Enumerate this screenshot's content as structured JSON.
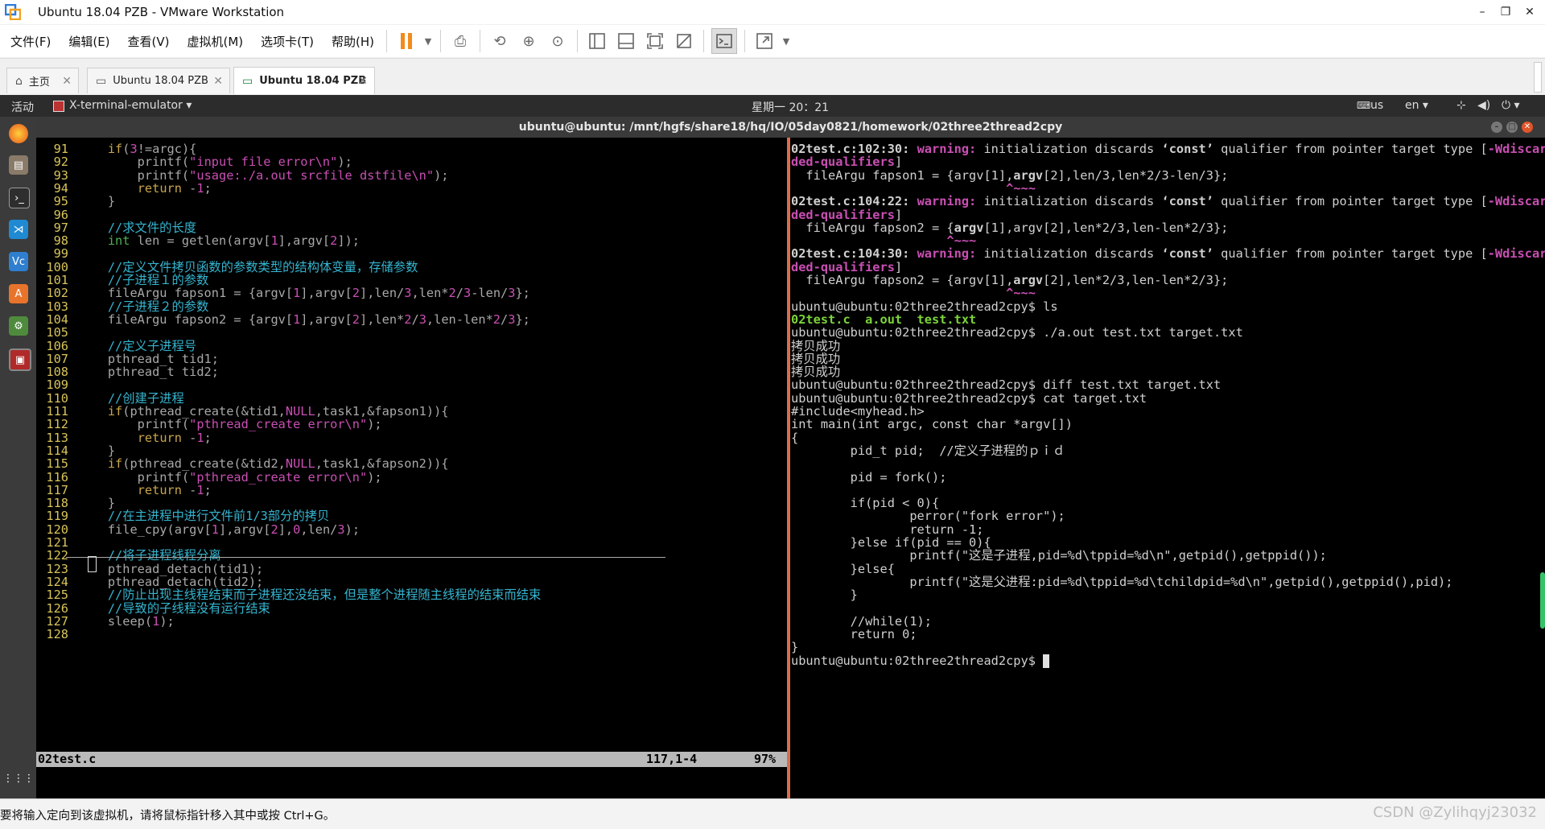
{
  "window": {
    "title": "Ubuntu 18.04 PZB - VMware Workstation",
    "minimize": "–",
    "restore": "❐",
    "close": "✕"
  },
  "menu": [
    "文件(F)",
    "编辑(E)",
    "查看(V)",
    "虚拟机(M)",
    "选项卡(T)",
    "帮助(H)"
  ],
  "tabs": [
    {
      "label": "主页",
      "icon": "home-icon"
    },
    {
      "label": "Ubuntu 18.04 PZB",
      "icon": "vm-icon"
    },
    {
      "label": "Ubuntu 18.04 PZB",
      "icon": "vm-icon",
      "active": true
    }
  ],
  "ubuntu_panel": {
    "activities": "活动",
    "app": "X-terminal-emulator ▾",
    "clock": "星期一 20：21",
    "input": "us",
    "lang": "en ▾"
  },
  "terminal_title": "ubuntu@ubuntu: /mnt/hgfs/share18/hq/IO/05day0821/homework/02three2thread2cpy",
  "vim": {
    "status_file": "02test.c",
    "status_pos": "117,1-4",
    "status_pct": "97%",
    "lines": [
      {
        "n": "91",
        "segs": [
          [
            "def",
            "    "
          ],
          [
            "kw",
            "if"
          ],
          [
            "def",
            "("
          ],
          [
            "num",
            "3"
          ],
          [
            "def",
            "!=argc){"
          ]
        ]
      },
      {
        "n": "92",
        "segs": [
          [
            "def",
            "        printf("
          ],
          [
            "str",
            "\"input file error\\n\""
          ],
          [
            "def",
            ");"
          ]
        ]
      },
      {
        "n": "93",
        "segs": [
          [
            "def",
            "        printf("
          ],
          [
            "str",
            "\"usage:./a.out srcfile dstfile\\n\""
          ],
          [
            "def",
            ");"
          ]
        ]
      },
      {
        "n": "94",
        "segs": [
          [
            "def",
            "        "
          ],
          [
            "kw",
            "return"
          ],
          [
            "def",
            " -"
          ],
          [
            "num",
            "1"
          ],
          [
            "def",
            ";"
          ]
        ]
      },
      {
        "n": "95",
        "segs": [
          [
            "def",
            "    }"
          ]
        ]
      },
      {
        "n": "96",
        "segs": []
      },
      {
        "n": "97",
        "segs": [
          [
            "cmt",
            "    //求文件的长度"
          ]
        ]
      },
      {
        "n": "98",
        "segs": [
          [
            "type",
            "    int"
          ],
          [
            "def",
            " len = getlen(argv["
          ],
          [
            "num",
            "1"
          ],
          [
            "def",
            "],argv["
          ],
          [
            "num",
            "2"
          ],
          [
            "def",
            "]);"
          ]
        ]
      },
      {
        "n": "99",
        "segs": []
      },
      {
        "n": "100",
        "segs": [
          [
            "cmt",
            "    //定义文件拷贝函数的参数类型的结构体变量，存储参数"
          ]
        ]
      },
      {
        "n": "101",
        "segs": [
          [
            "cmt",
            "    //子进程１的参数"
          ]
        ]
      },
      {
        "n": "102",
        "segs": [
          [
            "def",
            "    fileArgu fapson1 = {argv["
          ],
          [
            "num",
            "1"
          ],
          [
            "def",
            "],argv["
          ],
          [
            "num",
            "2"
          ],
          [
            "def",
            "],len/"
          ],
          [
            "num",
            "3"
          ],
          [
            "def",
            ",len*"
          ],
          [
            "num",
            "2"
          ],
          [
            "def",
            "/"
          ],
          [
            "num",
            "3"
          ],
          [
            "def",
            "-len/"
          ],
          [
            "num",
            "3"
          ],
          [
            "def",
            "};"
          ]
        ]
      },
      {
        "n": "103",
        "segs": [
          [
            "cmt",
            "    //子进程２的参数"
          ]
        ]
      },
      {
        "n": "104",
        "segs": [
          [
            "def",
            "    fileArgu fapson2 = {argv["
          ],
          [
            "num",
            "1"
          ],
          [
            "def",
            "],argv["
          ],
          [
            "num",
            "2"
          ],
          [
            "def",
            "],len*"
          ],
          [
            "num",
            "2"
          ],
          [
            "def",
            "/"
          ],
          [
            "num",
            "3"
          ],
          [
            "def",
            ",len-len*"
          ],
          [
            "num",
            "2"
          ],
          [
            "def",
            "/"
          ],
          [
            "num",
            "3"
          ],
          [
            "def",
            "};"
          ]
        ]
      },
      {
        "n": "105",
        "segs": []
      },
      {
        "n": "106",
        "segs": [
          [
            "cmt",
            "    //定义子进程号"
          ]
        ]
      },
      {
        "n": "107",
        "segs": [
          [
            "def",
            "    pthread_t tid1;"
          ]
        ]
      },
      {
        "n": "108",
        "segs": [
          [
            "def",
            "    pthread_t tid2;"
          ]
        ]
      },
      {
        "n": "109",
        "segs": []
      },
      {
        "n": "110",
        "segs": [
          [
            "cmt",
            "    //创建子进程"
          ]
        ]
      },
      {
        "n": "111",
        "segs": [
          [
            "def",
            "    "
          ],
          [
            "kw",
            "if"
          ],
          [
            "def",
            "(pthread_create(&tid1,"
          ],
          [
            "num",
            "NULL"
          ],
          [
            "def",
            ",task1,&fapson1)){"
          ]
        ]
      },
      {
        "n": "112",
        "segs": [
          [
            "def",
            "        printf("
          ],
          [
            "str",
            "\"pthread_create error\\n\""
          ],
          [
            "def",
            ");"
          ]
        ]
      },
      {
        "n": "113",
        "segs": [
          [
            "def",
            "        "
          ],
          [
            "kw",
            "return"
          ],
          [
            "def",
            " -"
          ],
          [
            "num",
            "1"
          ],
          [
            "def",
            ";"
          ]
        ]
      },
      {
        "n": "114",
        "segs": [
          [
            "def",
            "    }"
          ]
        ]
      },
      {
        "n": "115",
        "segs": [
          [
            "def",
            "    "
          ],
          [
            "kw",
            "if"
          ],
          [
            "def",
            "(pthread_create(&tid2,"
          ],
          [
            "num",
            "NULL"
          ],
          [
            "def",
            ",task1,&fapson2)){"
          ]
        ]
      },
      {
        "n": "116",
        "segs": [
          [
            "def",
            "        printf("
          ],
          [
            "str",
            "\"pthread_create error\\n\""
          ],
          [
            "def",
            ");"
          ]
        ]
      },
      {
        "n": "117",
        "segs": [
          [
            "def",
            "        "
          ],
          [
            "kw",
            "return"
          ],
          [
            "def",
            " -"
          ],
          [
            "num",
            "1"
          ],
          [
            "def",
            ";"
          ]
        ]
      },
      {
        "n": "118",
        "segs": [
          [
            "def",
            "    }"
          ]
        ]
      },
      {
        "n": "119",
        "segs": [
          [
            "cmt",
            "    //在主进程中进行文件前1/3部分的拷贝"
          ]
        ]
      },
      {
        "n": "120",
        "segs": [
          [
            "def",
            "    file_cpy(argv["
          ],
          [
            "num",
            "1"
          ],
          [
            "def",
            "],argv["
          ],
          [
            "num",
            "2"
          ],
          [
            "def",
            "],"
          ],
          [
            "num",
            "0"
          ],
          [
            "def",
            ",len/"
          ],
          [
            "num",
            "3"
          ],
          [
            "def",
            ");"
          ]
        ]
      },
      {
        "n": "121",
        "segs": []
      },
      {
        "n": "122",
        "segs": [
          [
            "cmt",
            "    //将子进程线程分离"
          ]
        ]
      },
      {
        "n": "123",
        "segs": [
          [
            "def",
            "    pthread_detach(tid1);"
          ]
        ]
      },
      {
        "n": "124",
        "segs": [
          [
            "def",
            "    pthread_detach(tid2);"
          ]
        ]
      },
      {
        "n": "125",
        "segs": [
          [
            "cmt",
            "    //防止出现主线程结束而子进程还没结束，但是整个进程随主线程的结束而结束"
          ]
        ]
      },
      {
        "n": "126",
        "segs": [
          [
            "cmt",
            "    //导致的子线程没有运行结束"
          ]
        ]
      },
      {
        "n": "127",
        "segs": [
          [
            "def",
            "    sleep("
          ],
          [
            "num",
            "1"
          ],
          [
            "def",
            ");"
          ]
        ]
      },
      {
        "n": "128",
        "segs": []
      }
    ]
  },
  "shell": {
    "lines": [
      [
        [
          "b",
          "02test.c:102:30: "
        ],
        [
          "warn",
          "warning: "
        ],
        [
          "",
          "initialization discards "
        ],
        [
          "b",
          "‘const’"
        ],
        [
          "",
          " qualifier from pointer target type ["
        ],
        [
          "warn",
          "-Wdiscar"
        ]
      ],
      [
        [
          "warn",
          "ded-qualifiers"
        ],
        [
          "",
          "]"
        ]
      ],
      [
        [
          "",
          "  fileArgu fapson1 = {argv[1],"
        ],
        [
          "b",
          "argv"
        ],
        [
          "",
          "[2],len/3,len*2/3-len/3};"
        ]
      ],
      [
        [
          "warn",
          "                             ^~~~"
        ]
      ],
      [
        [
          "b",
          "02test.c:104:22: "
        ],
        [
          "warn",
          "warning: "
        ],
        [
          "",
          "initialization discards "
        ],
        [
          "b",
          "‘const’"
        ],
        [
          "",
          " qualifier from pointer target type ["
        ],
        [
          "warn",
          "-Wdiscar"
        ]
      ],
      [
        [
          "warn",
          "ded-qualifiers"
        ],
        [
          "",
          "]"
        ]
      ],
      [
        [
          "",
          "  fileArgu fapson2 = {"
        ],
        [
          "b",
          "argv"
        ],
        [
          "",
          "[1],argv[2],len*2/3,len-len*2/3};"
        ]
      ],
      [
        [
          "warn",
          "                     ^~~~"
        ]
      ],
      [
        [
          "b",
          "02test.c:104:30: "
        ],
        [
          "warn",
          "warning: "
        ],
        [
          "",
          "initialization discards "
        ],
        [
          "b",
          "‘const’"
        ],
        [
          "",
          " qualifier from pointer target type ["
        ],
        [
          "warn",
          "-Wdiscar"
        ]
      ],
      [
        [
          "warn",
          "ded-qualifiers"
        ],
        [
          "",
          "]"
        ]
      ],
      [
        [
          "",
          "  fileArgu fapson2 = {argv[1],"
        ],
        [
          "b",
          "argv"
        ],
        [
          "",
          "[2],len*2/3,len-len*2/3};"
        ]
      ],
      [
        [
          "warn",
          "                             ^~~~"
        ]
      ],
      [
        [
          "",
          "ubuntu@ubuntu:02three2thread2cpy$ ls"
        ]
      ],
      [
        [
          "grn",
          "02test.c  a.out  test.txt"
        ]
      ],
      [
        [
          "",
          "ubuntu@ubuntu:02three2thread2cpy$ ./a.out test.txt target.txt"
        ]
      ],
      [
        [
          "",
          "拷贝成功"
        ]
      ],
      [
        [
          "",
          "拷贝成功"
        ]
      ],
      [
        [
          "",
          "拷贝成功"
        ]
      ],
      [
        [
          "",
          "ubuntu@ubuntu:02three2thread2cpy$ diff test.txt target.txt"
        ]
      ],
      [
        [
          "",
          "ubuntu@ubuntu:02three2thread2cpy$ cat target.txt"
        ]
      ],
      [
        [
          "",
          "#include<myhead.h>"
        ]
      ],
      [
        [
          "",
          "int main(int argc, const char *argv[])"
        ]
      ],
      [
        [
          "",
          "{"
        ]
      ],
      [
        [
          "",
          "        pid_t pid;  //定义子进程的ｐｉｄ"
        ]
      ],
      [
        [
          "",
          ""
        ]
      ],
      [
        [
          "",
          "        pid = fork();"
        ]
      ],
      [
        [
          "",
          ""
        ]
      ],
      [
        [
          "",
          "        if(pid < 0){"
        ]
      ],
      [
        [
          "",
          "                perror(\"fork error\");"
        ]
      ],
      [
        [
          "",
          "                return -1;"
        ]
      ],
      [
        [
          "",
          "        }else if(pid == 0){"
        ]
      ],
      [
        [
          "",
          "                printf(\"这是子进程,pid=%d\\tppid=%d\\n\",getpid(),getppid());"
        ]
      ],
      [
        [
          "",
          "        }else{"
        ]
      ],
      [
        [
          "",
          "                printf(\"这是父进程:pid=%d\\tppid=%d\\tchildpid=%d\\n\",getpid(),getppid(),pid);"
        ]
      ],
      [
        [
          "",
          "        }"
        ]
      ],
      [
        [
          "",
          ""
        ]
      ],
      [
        [
          "",
          "        //while(1);"
        ]
      ],
      [
        [
          "",
          "        return 0;"
        ]
      ],
      [
        [
          "",
          "}"
        ]
      ]
    ],
    "prompt": "ubuntu@ubuntu:02three2thread2cpy$ "
  },
  "bottom": {
    "message": "要将输入定向到该虚拟机，请将鼠标指针移入其中或按 Ctrl+G。",
    "watermark": "CSDN @Zylihqyj23032"
  }
}
